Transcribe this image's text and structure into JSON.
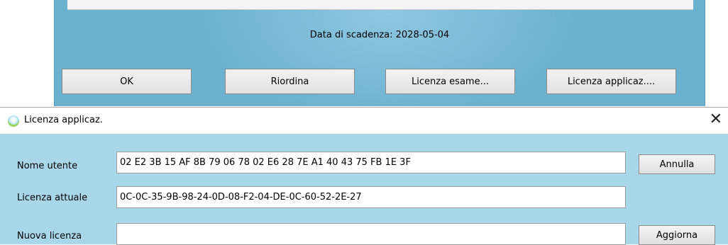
{
  "parent_dialog": {
    "expiry_text": "Data di scadenza: 2028-05-04",
    "buttons": {
      "ok": "OK",
      "reorder": "Riordina",
      "exam_license": "Licenza esame...",
      "app_license": "Licenza applicaz...."
    }
  },
  "license_dialog": {
    "title": "Licenza applicaz.",
    "close_glyph": "✕",
    "username_label": "Nome utente",
    "username_value": "02 E2 3B 15 AF 8B 79 06 78 02 E6 28 7E A1 40 43 75 FB 1E 3F",
    "current_license_label": "Licenza attuale",
    "current_license_value": "0C-0C-35-9B-98-24-0D-08-F2-04-DE-0C-60-52-2E-27",
    "new_license_label": "Nuova licenza",
    "new_license_value": "",
    "cancel_button": "Annulla",
    "update_button": "Aggiorna"
  }
}
